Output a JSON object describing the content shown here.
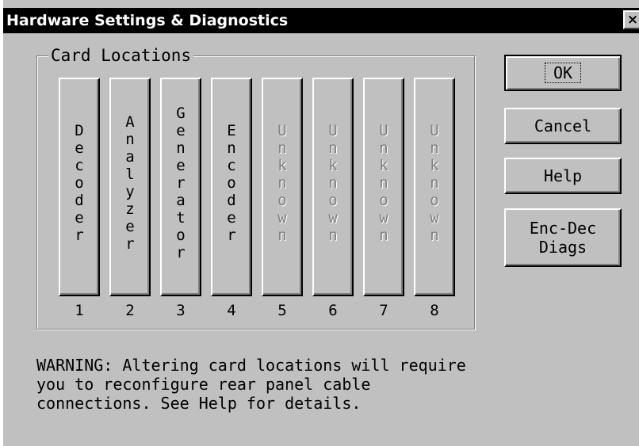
{
  "window": {
    "title": "Hardware Settings & Diagnostics",
    "close_label": "×"
  },
  "group": {
    "label": "Card Locations"
  },
  "cards": [
    {
      "name": "Decoder",
      "slot": "1",
      "enabled": true
    },
    {
      "name": "Analyzer",
      "slot": "2",
      "enabled": true
    },
    {
      "name": "Generator",
      "slot": "3",
      "enabled": true
    },
    {
      "name": "Encoder",
      "slot": "4",
      "enabled": true
    },
    {
      "name": "Unknown",
      "slot": "5",
      "enabled": false
    },
    {
      "name": "Unknown",
      "slot": "6",
      "enabled": false
    },
    {
      "name": "Unknown",
      "slot": "7",
      "enabled": false
    },
    {
      "name": "Unknown",
      "slot": "8",
      "enabled": false
    }
  ],
  "buttons": {
    "ok": "OK",
    "cancel": "Cancel",
    "help": "Help",
    "enc_dec_diags_line1": "Enc-Dec",
    "enc_dec_diags_line2": "Diags"
  },
  "warning": {
    "line1": "WARNING: Altering card locations will require",
    "line2": "you to reconfigure rear panel cable",
    "line3": "connections. See Help for details."
  },
  "colors": {
    "face": "#c0c0c0",
    "titlebar": "#000000",
    "disabled_text": "#808080"
  }
}
